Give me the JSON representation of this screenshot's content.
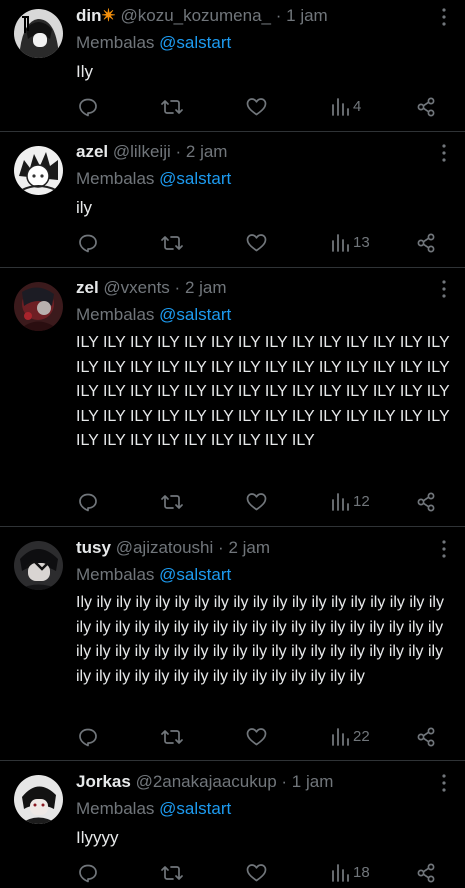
{
  "tweets": [
    {
      "name": "din",
      "name_emoji": "✴",
      "handle": "@kozu_kozumena_",
      "time": "1 jam",
      "reply_prefix": "Membalas",
      "reply_to": "@salstart",
      "text": "Ily",
      "views": "4"
    },
    {
      "name": "azel",
      "handle": "@lilkeiji",
      "time": "2 jam",
      "reply_prefix": "Membalas",
      "reply_to": "@salstart",
      "text": "ily",
      "views": "13"
    },
    {
      "name": "zel",
      "handle": "@vxents",
      "time": "2 jam",
      "reply_prefix": "Membalas",
      "reply_to": "@salstart",
      "text": "ILY ILY ILY ILY ILY ILY ILY ILY ILY ILY ILY ILY ILY ILY ILY ILY ILY ILY ILY ILY ILY ILY ILY ILY ILY ILY ILY ILY ILY ILY ILY ILY ILY ILY ILY ILY ILY ILY ILY ILY ILY ILY ILY ILY ILY ILY ILY ILY ILY ILY ILY ILY ILY ILY ILY ILY ILY ILY ILY ILY ILY ILY ILY ILY ILY",
      "views": "12"
    },
    {
      "name": "tusy",
      "handle": "@ajizatoushi",
      "time": "2 jam",
      "reply_prefix": "Membalas",
      "reply_to": "@salstart",
      "text": "Ily ily ily ily ily ily ily ily ily ily ily ily ily ily ily ily ily ily ily ily ily ily ily ily ily ily ily ily ily ily ily ily ily ily ily ily ily ily ily ily ily ily ily ily ily ily ily ily ily ily ily ily ily ily ily ily ily ily ily ily ily ily ily ily ily ily ily ily ily ily ily ily",
      "views": "22"
    },
    {
      "name": "Jorkas",
      "handle": "@2anakajaacukup",
      "time": "1 jam",
      "reply_prefix": "Membalas",
      "reply_to": "@salstart",
      "text": "Ilyyyy",
      "views": "18"
    }
  ],
  "icons": {
    "reply": "reply-icon",
    "retweet": "retweet-icon",
    "like": "heart-icon",
    "views": "views-icon",
    "share": "share-icon",
    "more": "more-icon"
  },
  "colors": {
    "background": "#000000",
    "text": "#e7e9ea",
    "muted": "#71767b",
    "mention": "#1d9bf0",
    "divider": "#2f3336"
  }
}
